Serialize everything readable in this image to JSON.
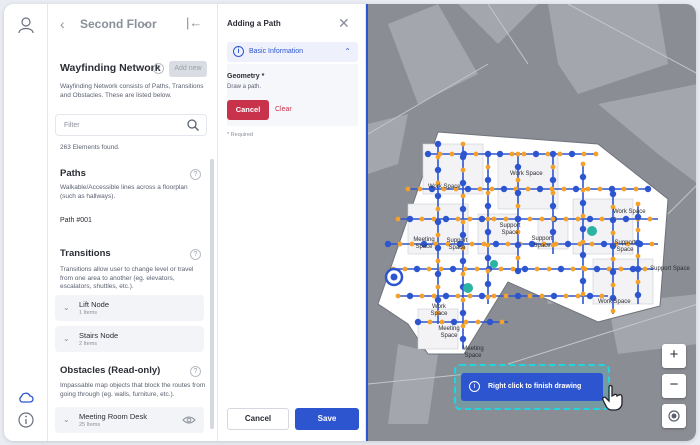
{
  "rail": {
    "top_icon": "user-icon",
    "bottom_icons": [
      "cloud-icon",
      "info-icon"
    ]
  },
  "floor": {
    "name": "Second Floor"
  },
  "network": {
    "title": "Wayfinding Network",
    "add_new": "Add new",
    "description": "Wayfinding Network consists of Paths, Transitions and Obstacles. These are listed below.",
    "filter_placeholder": "Filter",
    "count": "263 Elements found."
  },
  "paths": {
    "title": "Paths",
    "description": "Walkable/Accessible lines across a floorplan (such as hallways).",
    "items": [
      "Path #001"
    ]
  },
  "transitions": {
    "title": "Transitions",
    "description": "Transitions allow user to change level or travel from one area to another (eg. elevators, escalators, shuttles, etc.).",
    "items": [
      {
        "name": "Lift Node",
        "count": "1 Items"
      },
      {
        "name": "Stairs Node",
        "count": "2 Items"
      }
    ]
  },
  "obstacles": {
    "title": "Obstacles (Read-only)",
    "description": "Impassable map objects that block the routes from going through (eg. walls, furniture, etc.).",
    "items": [
      {
        "name": "Meeting Room Desk",
        "count": "25 Items"
      }
    ]
  },
  "form": {
    "title": "Adding a Path",
    "section": "Basic Information",
    "geometry_label": "Geometry *",
    "geometry_hint": "Draw a path.",
    "cancel_small": "Cancel",
    "clear": "Clear",
    "required_note": "* Required",
    "cancel": "Cancel",
    "save": "Save"
  },
  "map": {
    "rooms": [
      "Work Space",
      "Work Space",
      "Work Space",
      "Meeting Space",
      "Support Space",
      "Support Space",
      "Support Space",
      "Work Space",
      "Work Space",
      "Support Space",
      "Support Space",
      "Meeting Space",
      "Meeting Space"
    ],
    "toast": "Right click to finish drawing",
    "zoom_in": "+",
    "zoom_out": "−"
  },
  "colors": {
    "accent": "#2d55d0",
    "danger": "#c8324a",
    "highlight": "#22d3e0",
    "node_orange": "#f5a02a"
  }
}
